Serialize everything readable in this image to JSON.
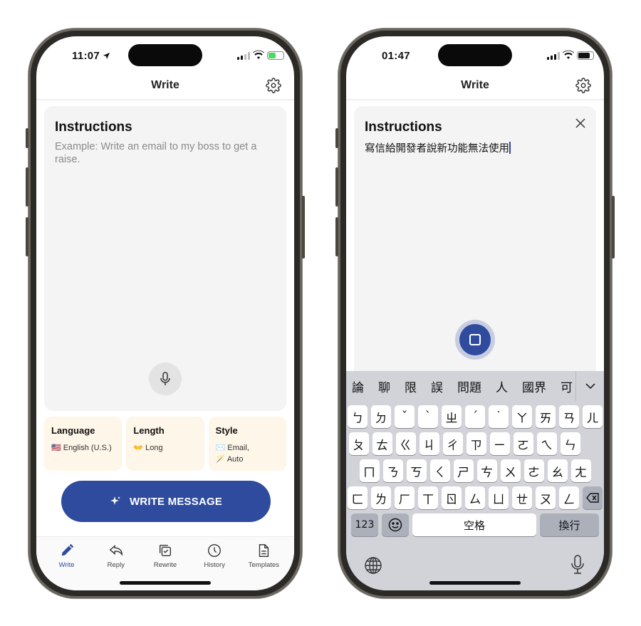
{
  "left": {
    "status": {
      "time": "11:07",
      "battery_color": "#4cd964",
      "battery_level": 0.5
    },
    "header": {
      "title": "Write"
    },
    "instructions": {
      "title": "Instructions",
      "placeholder": "Example: Write an email to my boss to get a raise."
    },
    "options": [
      {
        "label": "Language",
        "icon": "🇺🇸",
        "value": "English (U.S.)"
      },
      {
        "label": "Length",
        "icon": "👐",
        "value": "Long"
      },
      {
        "label": "Style",
        "icon": "✉️",
        "value": "Email,",
        "icon2": "🪄",
        "value2": "Auto"
      }
    ],
    "write_button": {
      "label": "WRITE MESSAGE",
      "color": "#2f4b9d"
    },
    "tabs": [
      {
        "label": "Write",
        "icon": "pencil-icon",
        "active": true
      },
      {
        "label": "Reply",
        "icon": "reply-icon"
      },
      {
        "label": "Rewrite",
        "icon": "rewrite-icon"
      },
      {
        "label": "History",
        "icon": "clock-icon"
      },
      {
        "label": "Templates",
        "icon": "document-icon"
      }
    ]
  },
  "right": {
    "status": {
      "time": "01:47",
      "battery_color": "#111111",
      "battery_level": 0.8
    },
    "header": {
      "title": "Write"
    },
    "instructions": {
      "title": "Instructions",
      "value": "寫信給開發者說新功能無法使用"
    },
    "keyboard": {
      "candidates": [
        "論",
        "聊",
        "限",
        "誤",
        "問題",
        "人",
        "國界",
        "可"
      ],
      "row1": [
        "ㄅ",
        "ㄉ",
        "ˇ",
        "ˋ",
        "ㄓ",
        "ˊ",
        "˙",
        "ㄚ",
        "ㄞ",
        "ㄢ",
        "ㄦ"
      ],
      "row2": [
        "ㄆ",
        "ㄊ",
        "ㄍ",
        "ㄐ",
        "ㄔ",
        "ㄗ",
        "ㄧ",
        "ㄛ",
        "ㄟ",
        "ㄣ"
      ],
      "row3": [
        "ㄇ",
        "ㄋ",
        "ㄎ",
        "ㄑ",
        "ㄕ",
        "ㄘ",
        "ㄨ",
        "ㄜ",
        "ㄠ",
        "ㄤ"
      ],
      "row4": [
        "ㄈ",
        "ㄌ",
        "ㄏ",
        "ㄒ",
        "ㄖ",
        "ㄙ",
        "ㄩ",
        "ㄝ",
        "ㄡ",
        "ㄥ"
      ],
      "numbers_key": "123",
      "space_key": "空格",
      "return_key": "換行"
    }
  }
}
